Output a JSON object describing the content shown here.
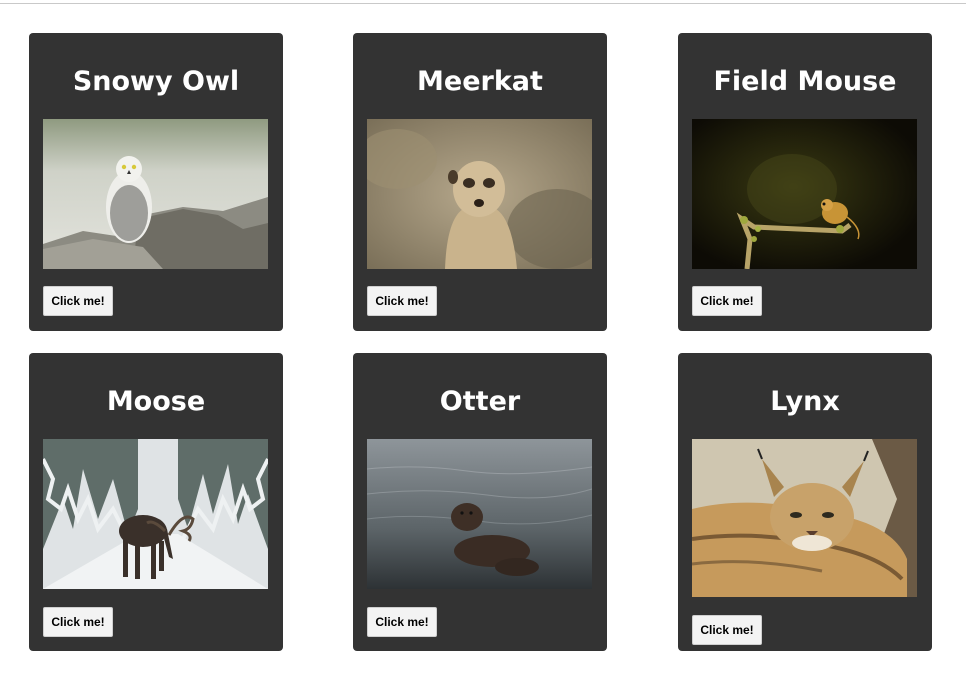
{
  "cards": [
    {
      "title": "Snowy Owl",
      "image": "snowy-owl-photo",
      "button_label": "Click me!"
    },
    {
      "title": "Meerkat",
      "image": "meerkat-photo",
      "button_label": "Click me!"
    },
    {
      "title": "Field Mouse",
      "image": "field-mouse-photo",
      "button_label": "Click me!"
    },
    {
      "title": "Moose",
      "image": "moose-photo",
      "button_label": "Click me!"
    },
    {
      "title": "Otter",
      "image": "otter-photo",
      "button_label": "Click me!"
    },
    {
      "title": "Lynx",
      "image": "lynx-photo",
      "button_label": "Click me!"
    }
  ],
  "colors": {
    "card_background": "#333333",
    "title_text": "#ffffff",
    "button_background": "#f3f3f3",
    "page_background": "#ffffff"
  }
}
